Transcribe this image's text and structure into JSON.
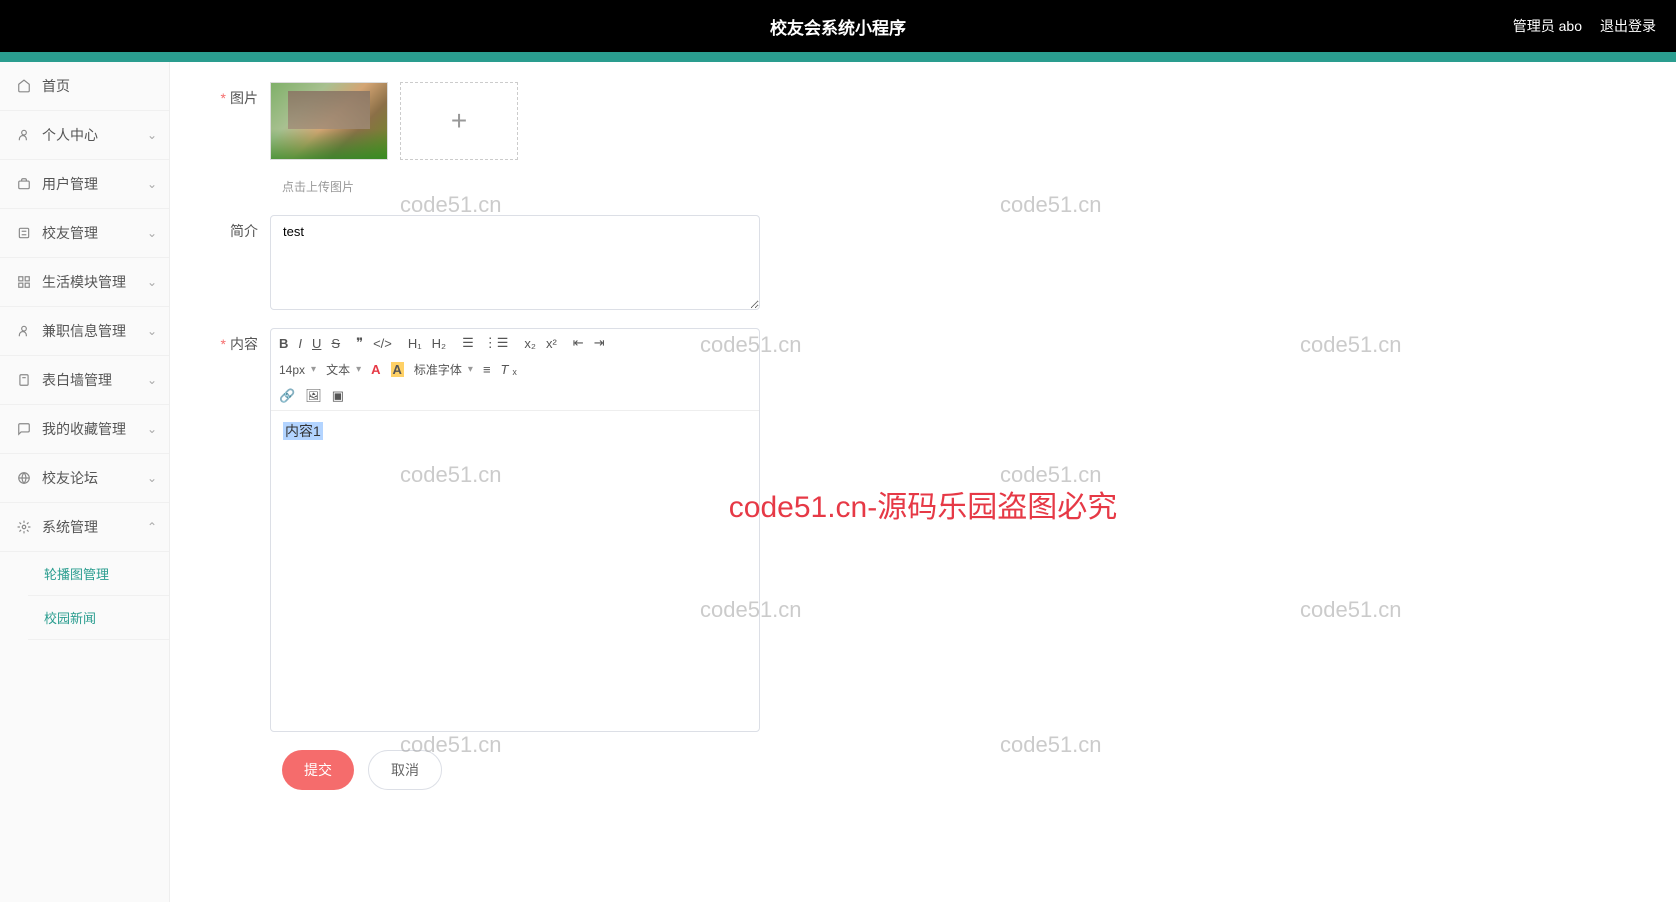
{
  "header": {
    "title": "校友会系统小程序",
    "admin_label": "管理员 abo",
    "logout_label": "退出登录"
  },
  "sidebar": {
    "items": [
      {
        "label": "首页",
        "icon": "home",
        "expandable": false
      },
      {
        "label": "个人中心",
        "icon": "user",
        "expandable": true
      },
      {
        "label": "用户管理",
        "icon": "briefcase",
        "expandable": true
      },
      {
        "label": "校友管理",
        "icon": "list",
        "expandable": true
      },
      {
        "label": "生活模块管理",
        "icon": "grid",
        "expandable": true
      },
      {
        "label": "兼职信息管理",
        "icon": "person",
        "expandable": true
      },
      {
        "label": "表白墙管理",
        "icon": "clipboard",
        "expandable": true
      },
      {
        "label": "我的收藏管理",
        "icon": "chat",
        "expandable": true
      },
      {
        "label": "校友论坛",
        "icon": "globe",
        "expandable": true
      },
      {
        "label": "系统管理",
        "icon": "settings",
        "expandable": true,
        "expanded": true
      }
    ],
    "submenu": [
      {
        "label": "轮播图管理"
      },
      {
        "label": "校园新闻"
      }
    ]
  },
  "form": {
    "image_label": "图片",
    "upload_hint": "点击上传图片",
    "intro_label": "简介",
    "intro_value": "test",
    "content_label": "内容",
    "editor_content": "内容1",
    "font_size": "14px",
    "font_type": "文本",
    "font_family": "标准字体",
    "submit_label": "提交",
    "cancel_label": "取消"
  },
  "watermarks": {
    "text": "code51.cn",
    "red_text": "code51.cn-源码乐园盗图必究"
  }
}
